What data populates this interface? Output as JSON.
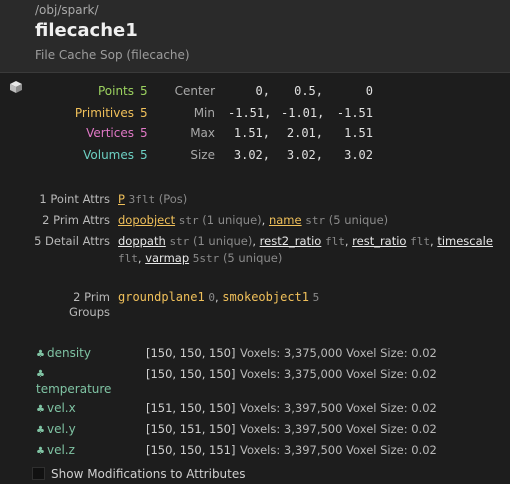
{
  "header": {
    "path": "/obj/spark/",
    "title": "filecache1",
    "subtitle": "File Cache Sop (filecache)"
  },
  "stats": [
    {
      "label": "Points",
      "value": "5",
      "color": "#9bd15f"
    },
    {
      "label": "Primitives",
      "value": "5",
      "color": "#f0c05a"
    },
    {
      "label": "Vertices",
      "value": "5",
      "color": "#e078c6"
    },
    {
      "label": "Volumes",
      "value": "5",
      "color": "#6dd0c3"
    }
  ],
  "bounds": {
    "center": {
      "label": "Center",
      "values": [
        "0,",
        "0.5,",
        "0"
      ]
    },
    "min": {
      "label": "Min",
      "values": [
        "-1.51,",
        "-1.01,",
        "-1.51"
      ]
    },
    "max": {
      "label": "Max",
      "values": [
        "1.51,",
        "2.01,",
        "1.51"
      ]
    },
    "size": {
      "label": "Size",
      "values": [
        "3.02,",
        "3.02,",
        "3.02"
      ]
    }
  },
  "attributes": {
    "point": {
      "label": "1 Point Attrs",
      "name": "P",
      "type": "3flt",
      "detail": "(Pos)"
    },
    "prim": {
      "label": "2 Prim Attrs",
      "items": [
        {
          "name": "dopobject",
          "type": "str",
          "detail": "(1 unique)"
        },
        {
          "name": "name",
          "type": "str",
          "detail": "(5 unique)"
        }
      ]
    },
    "detail": {
      "label": "5 Detail Attrs",
      "items": [
        {
          "name": "doppath",
          "type": "str",
          "detail": "(1 unique)"
        },
        {
          "name": "rest2_ratio",
          "type": "flt"
        },
        {
          "name": "rest_ratio",
          "type": "flt"
        },
        {
          "name": "timescale",
          "type": "flt"
        },
        {
          "name": "varmap",
          "type": "5str",
          "detail": "(5 unique)"
        }
      ]
    }
  },
  "groups": {
    "label_line1": "2 Prim",
    "label_line2": "Groups",
    "items": [
      {
        "name": "groundplane1",
        "count": "0"
      },
      {
        "name": "smokeobject1",
        "count": "5"
      }
    ]
  },
  "volumes": [
    {
      "name": "density",
      "res": "[150, 150, 150]",
      "info": "Voxels: 3,375,000 Voxel Size: 0.02"
    },
    {
      "name": "temperature",
      "res": "[150, 150, 150]",
      "info": "Voxels: 3,375,000 Voxel Size: 0.02"
    },
    {
      "name": "vel.x",
      "res": "[151, 150, 150]",
      "info": "Voxels: 3,397,500 Voxel Size: 0.02"
    },
    {
      "name": "vel.y",
      "res": "[150, 151, 150]",
      "info": "Voxels: 3,397,500 Voxel Size: 0.02"
    },
    {
      "name": "vel.z",
      "res": "[150, 150, 151]",
      "info": "Voxels: 3,397,500 Voxel Size: 0.02"
    }
  ],
  "footer": {
    "checkbox_label": "Show Modifications to Attributes",
    "checked": false
  },
  "icons": {
    "geometry": "cube-icon",
    "volume": "leaf-icon"
  }
}
